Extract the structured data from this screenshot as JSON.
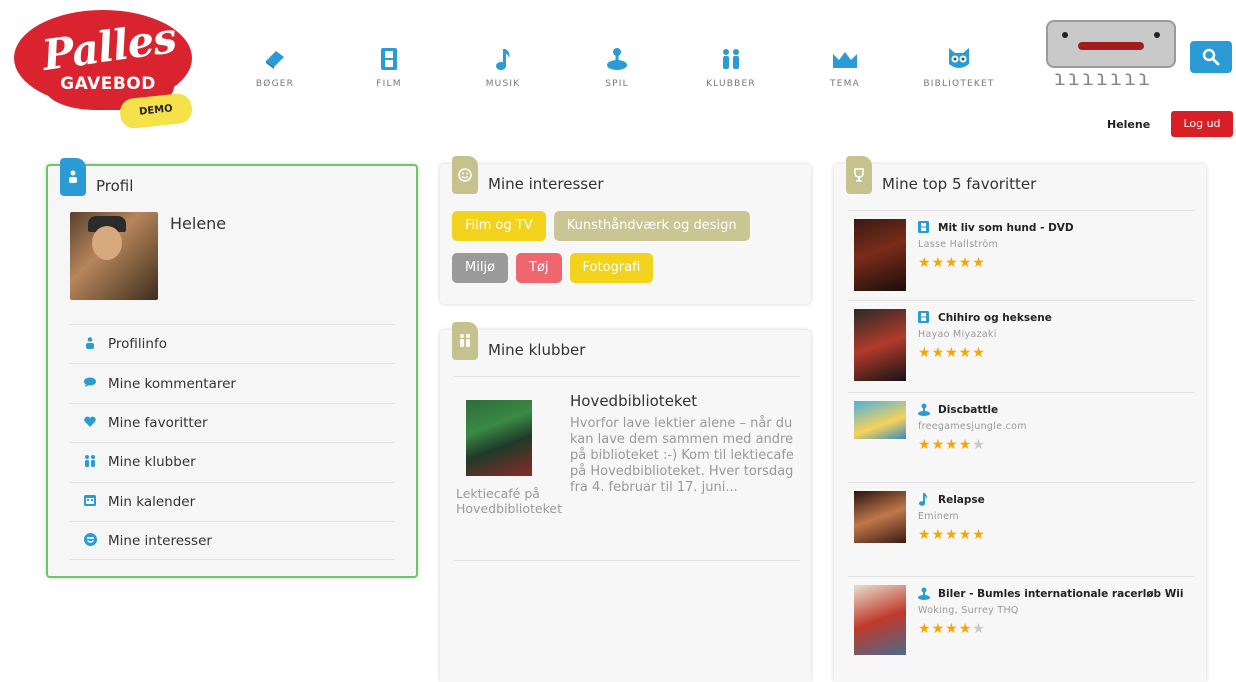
{
  "logo": {
    "word": "Palles",
    "sub": "GAVEBOD",
    "badge": "DEMO"
  },
  "nav": [
    {
      "label": "BØGER",
      "icon": "book-icon"
    },
    {
      "label": "FILM",
      "icon": "film-icon"
    },
    {
      "label": "MUSIK",
      "icon": "music-note-icon"
    },
    {
      "label": "SPIL",
      "icon": "joystick-icon"
    },
    {
      "label": "KLUBBER",
      "icon": "people-icon"
    },
    {
      "label": "TEMA",
      "icon": "crown-icon"
    },
    {
      "label": "BIBLIOTEKET",
      "icon": "owl-icon"
    }
  ],
  "header": {
    "user_name": "Helene",
    "logout_label": "Log ud",
    "search_icon": "search-icon"
  },
  "profile": {
    "title": "Profil",
    "name": "Helene",
    "menu": [
      {
        "label": "Profilinfo",
        "icon": "person-icon"
      },
      {
        "label": "Mine kommentarer",
        "icon": "speech-bubble-icon"
      },
      {
        "label": "Mine favoritter",
        "icon": "heart-icon"
      },
      {
        "label": "Mine klubber",
        "icon": "people-icon"
      },
      {
        "label": "Min kalender",
        "icon": "calendar-icon"
      },
      {
        "label": "Mine interesser",
        "icon": "smiley-icon"
      }
    ]
  },
  "interests": {
    "title": "Mine interesser",
    "tags": [
      {
        "label": "Film og TV",
        "color": "#f2d21b"
      },
      {
        "label": "Kunsthåndværk og design",
        "color": "#c9c694"
      },
      {
        "label": "Miljø",
        "color": "#9a9a9a"
      },
      {
        "label": "Tøj",
        "color": "#f0666e"
      },
      {
        "label": "Fotografi",
        "color": "#f2d21b"
      }
    ]
  },
  "clubs": {
    "title": "Mine klubber",
    "club_name": "Hovedbiblioteket",
    "description": "Hvorfor lave lektier alene – når du kan lave dem sammen med andre på biblioteket :-) Kom til lektiecafe på Hovedbiblioteket. Hver torsdag fra 4. februar til 17. juni...",
    "caption": "Lektiecafé på Hovedbiblioteket"
  },
  "favorites": {
    "title": "Mine top 5 favoritter",
    "items": [
      {
        "title": "Mit liv som hund - DVD",
        "subtitle": "Lasse Hallström",
        "rating": 5,
        "icon": "film-icon"
      },
      {
        "title": "Chihiro og heksene",
        "subtitle": "Hayao Miyazaki",
        "rating": 5,
        "icon": "film-icon"
      },
      {
        "title": "Discbattle",
        "subtitle": "freegamesjungle.com",
        "rating": 4,
        "icon": "joystick-icon"
      },
      {
        "title": "Relapse",
        "subtitle": "Eminem",
        "rating": 5,
        "icon": "music-note-icon"
      },
      {
        "title": "Biler - Bumles internationale racerløb Wii",
        "subtitle": "Woking, Surrey THQ",
        "rating": 4,
        "icon": "joystick-icon"
      }
    ]
  },
  "colors": {
    "accent_blue": "#2a9bd4",
    "logout_red": "#d91f26",
    "profile_border": "#6cc56b",
    "star_gold": "#f2a800"
  }
}
